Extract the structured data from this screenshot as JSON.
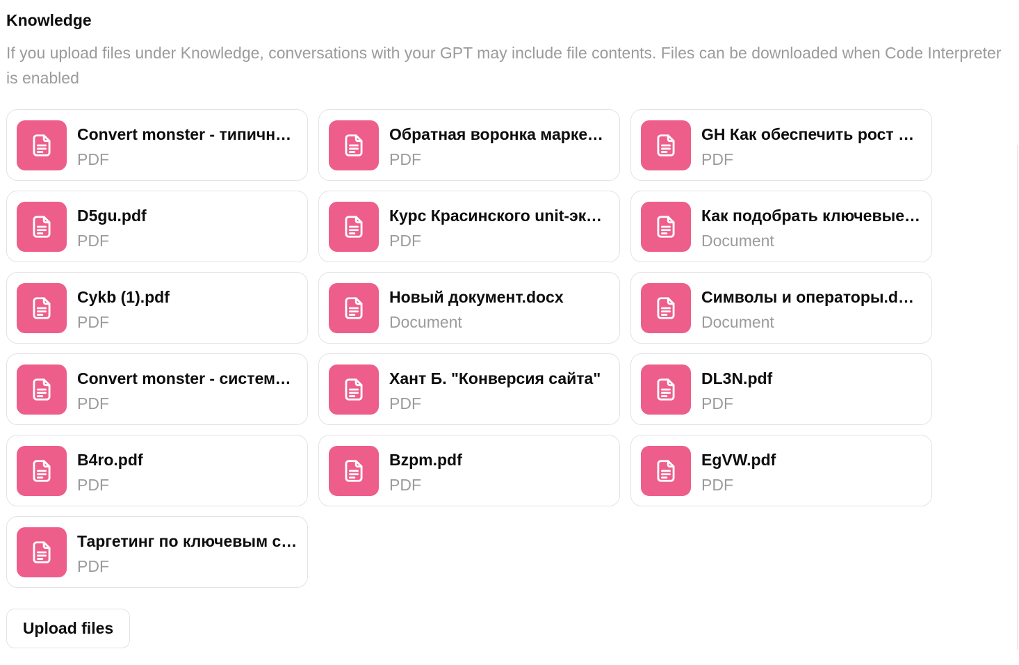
{
  "knowledge": {
    "title": "Knowledge",
    "description": "If you upload files under Knowledge, conversations with your GPT may include file contents. Files can be downloaded when Code Interpreter is enabled",
    "files": [
      {
        "name": "Convert monster - типичные ошибки",
        "type": "PDF"
      },
      {
        "name": "Обратная воронка маркетинга",
        "type": "PDF"
      },
      {
        "name": "GH Как обеспечить рост продаж",
        "type": "PDF"
      },
      {
        "name": "D5gu.pdf",
        "type": "PDF"
      },
      {
        "name": "Курс Красинского unit-экономика",
        "type": "PDF"
      },
      {
        "name": "Как подобрать ключевые слова",
        "type": "Document"
      },
      {
        "name": "Cykb (1).pdf",
        "type": "PDF"
      },
      {
        "name": "Новый документ.docx",
        "type": "Document"
      },
      {
        "name": "Символы и операторы.docx",
        "type": "Document"
      },
      {
        "name": "Convert monster - система продаж",
        "type": "PDF"
      },
      {
        "name": "Хант Б. \"Конверсия сайта\"",
        "type": "PDF"
      },
      {
        "name": "DL3N.pdf",
        "type": "PDF"
      },
      {
        "name": "B4ro.pdf",
        "type": "PDF"
      },
      {
        "name": "Bzpm.pdf",
        "type": "PDF"
      },
      {
        "name": "EgVW.pdf",
        "type": "PDF"
      },
      {
        "name": "Таргетинг по ключевым словам",
        "type": "PDF"
      }
    ],
    "icon": "file-document-icon",
    "icon_color": "#ee5e8a",
    "upload_label": "Upload files"
  }
}
